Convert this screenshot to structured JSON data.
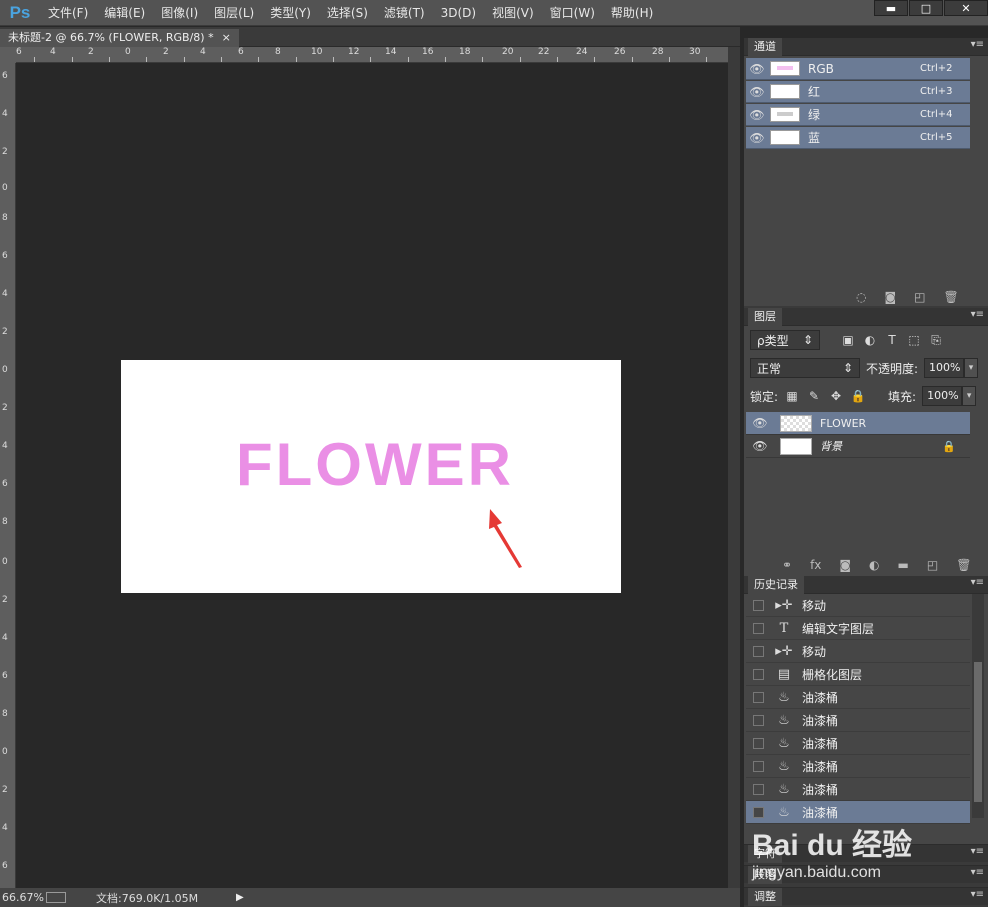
{
  "app": {
    "logo": "Ps"
  },
  "menu": [
    "文件(F)",
    "编辑(E)",
    "图像(I)",
    "图层(L)",
    "类型(Y)",
    "选择(S)",
    "滤镜(T)",
    "3D(D)",
    "视图(V)",
    "窗口(W)",
    "帮助(H)"
  ],
  "window_buttons": {
    "minimize": "▬",
    "maximize": "□",
    "close": "✕"
  },
  "document_tab": {
    "title": "未标题-2 @ 66.7% (FLOWER, RGB/8) *",
    "close": "×"
  },
  "ruler_h": [
    "6",
    "4",
    "2",
    "0",
    "2",
    "4",
    "6",
    "8",
    "10",
    "12",
    "14",
    "16",
    "18",
    "20",
    "22",
    "24",
    "26",
    "28",
    "30"
  ],
  "ruler_v": [
    "6",
    "4",
    "2",
    "0",
    "8",
    "6",
    "4",
    "2",
    "0",
    "2",
    "4",
    "6",
    "8",
    "0",
    "2",
    "4",
    "6",
    "8",
    "0",
    "2",
    "4",
    "6"
  ],
  "canvas": {
    "text": "FLOWER",
    "text_color": "#ea8fe5"
  },
  "status": {
    "zoom": "66.67%",
    "doc_info": "文档:769.0K/1.05M"
  },
  "channels": {
    "tab": "通道",
    "rows": [
      {
        "name": "RGB",
        "key": "Ctrl+2"
      },
      {
        "name": "红",
        "key": "Ctrl+3"
      },
      {
        "name": "绿",
        "key": "Ctrl+4"
      },
      {
        "name": "蓝",
        "key": "Ctrl+5"
      }
    ]
  },
  "layers": {
    "tab": "图层",
    "filter_label": "ρ类型",
    "blend_mode": "正常",
    "opacity_label": "不透明度:",
    "opacity": "100%",
    "lock_label": "锁定:",
    "fill_label": "填充:",
    "fill": "100%",
    "rows": [
      {
        "name": "FLOWER"
      },
      {
        "name": "背景"
      }
    ]
  },
  "history": {
    "tab": "历史记录",
    "rows": [
      {
        "icon": "move",
        "label": "移动"
      },
      {
        "icon": "type",
        "label": "编辑文字图层"
      },
      {
        "icon": "move",
        "label": "移动"
      },
      {
        "icon": "rasterize",
        "label": "栅格化图层"
      },
      {
        "icon": "bucket",
        "label": "油漆桶"
      },
      {
        "icon": "bucket",
        "label": "油漆桶"
      },
      {
        "icon": "bucket",
        "label": "油漆桶"
      },
      {
        "icon": "bucket",
        "label": "油漆桶"
      },
      {
        "icon": "bucket",
        "label": "油漆桶"
      },
      {
        "icon": "bucket",
        "label": "油漆桶"
      }
    ]
  },
  "bottom_panels": [
    "字符",
    "段落",
    "调整"
  ],
  "watermark": {
    "brand": "Bai du 经验",
    "url": "jingyan.baidu.com"
  }
}
